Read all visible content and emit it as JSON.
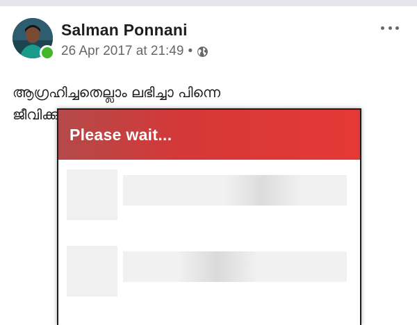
{
  "post": {
    "author": "Salman Ponnani",
    "date": "26 Apr 2017 at 21:49",
    "separator": "•",
    "privacy_icon": "globe-icon",
    "more_icon": "more-options-icon",
    "text_line1": "ആഗ്രഹിച്ചതെല്ലാം ലഭിച്ചാ പിന്നെ",
    "text_line2": "ജീവിക്കുന്നതിനെന്തർത്ഥം"
  },
  "dialog": {
    "title": "Please wait...",
    "placeholder_rows": 2
  },
  "colors": {
    "header_red": "#e53935",
    "online_green": "#42b72a",
    "text_primary": "#1c1e21",
    "text_secondary": "#65676b"
  }
}
